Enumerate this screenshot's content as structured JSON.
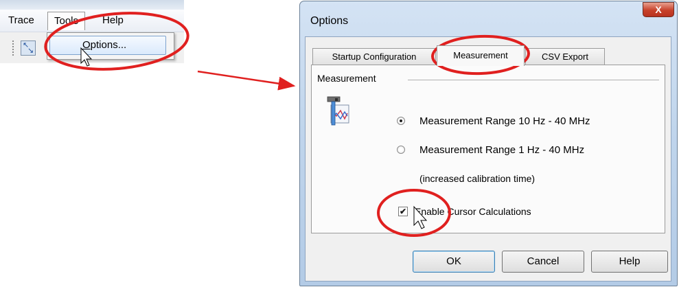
{
  "menu": {
    "items": [
      "Trace",
      "Tools",
      "Help"
    ],
    "dropdown_option": "Options...",
    "dropdown_mnemonic": "O",
    "dropdown_rest": "ptions..."
  },
  "dialog": {
    "title": "Options",
    "close_glyph": "X",
    "tabs": [
      "Startup Configuration",
      "Measurement",
      "CSV Export"
    ],
    "active_tab": "Measurement",
    "group_label": "Measurement",
    "radio_options": [
      {
        "label": "Measurement Range 10 Hz - 40 MHz",
        "checked": true
      },
      {
        "label": "Measurement Range 1 Hz - 40 MHz",
        "checked": false
      }
    ],
    "note": "(increased calibration time)",
    "checkbox": {
      "label": "Enable Cursor Calculations",
      "checked": true,
      "mark": "✔"
    },
    "buttons": {
      "ok": "OK",
      "cancel": "Cancel",
      "help": "Help"
    }
  },
  "colors": {
    "annotation_red": "#e0201f",
    "titlebar_blue": "#c3d7ee",
    "close_red": "#c7412a"
  },
  "icons": [
    "toolbar-tool-icon",
    "mouse-pointer-icon",
    "close-icon",
    "hammer-measurement-icon",
    "checkmark-icon"
  ]
}
